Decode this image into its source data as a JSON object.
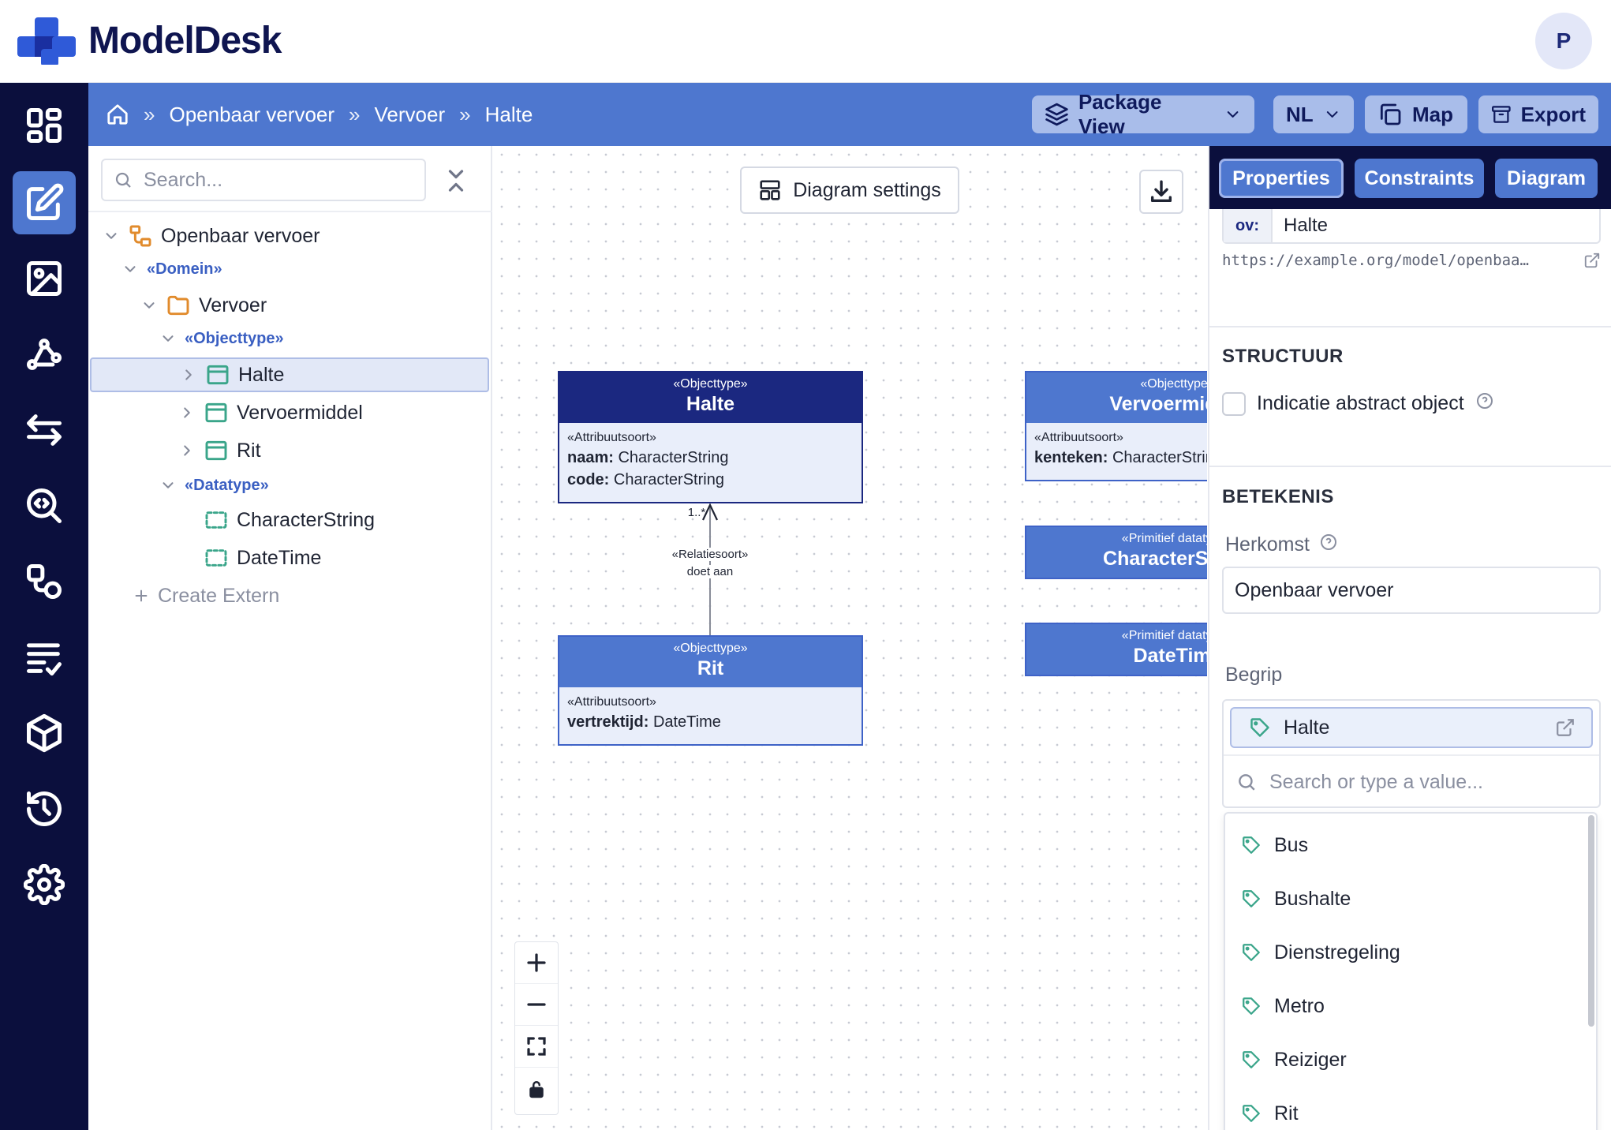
{
  "app": {
    "name": "ModelDesk",
    "avatar_initial": "P"
  },
  "sidebar": {
    "items": [
      {
        "icon": "dashboard-icon"
      },
      {
        "icon": "edit-icon",
        "active": true
      },
      {
        "icon": "image-icon"
      },
      {
        "icon": "graph-icon"
      },
      {
        "icon": "arrows-exchange-icon"
      },
      {
        "icon": "code-search-icon"
      },
      {
        "icon": "shapes-icon"
      },
      {
        "icon": "checklist-icon"
      },
      {
        "icon": "package-icon"
      },
      {
        "icon": "history-icon"
      },
      {
        "icon": "settings-icon"
      }
    ]
  },
  "breadcrumb": {
    "items": [
      "Openbaar vervoer",
      "Vervoer",
      "Halte"
    ],
    "separator": "»"
  },
  "toolbar": {
    "package_view": "Package View",
    "language": "NL",
    "map": "Map",
    "export": "Export"
  },
  "tree": {
    "search_placeholder": "Search...",
    "nodes": [
      {
        "label": "Openbaar vervoer",
        "kind": "model"
      },
      {
        "label": "«Domein»",
        "kind": "stereotype"
      },
      {
        "label": "Vervoer",
        "kind": "folder"
      },
      {
        "label": "«Objecttype»",
        "kind": "stereotype"
      },
      {
        "label": "Halte",
        "kind": "objecttype",
        "selected": true
      },
      {
        "label": "Vervoermiddel",
        "kind": "objecttype"
      },
      {
        "label": "Rit",
        "kind": "objecttype"
      },
      {
        "label": "«Datatype»",
        "kind": "stereotype"
      },
      {
        "label": "CharacterString",
        "kind": "datatype"
      },
      {
        "label": "DateTime",
        "kind": "datatype"
      }
    ],
    "create_extern": "Create Extern"
  },
  "canvas": {
    "settings_button": "Diagram settings",
    "boxes": {
      "halte": {
        "stereotype": "«Objecttype»",
        "name": "Halte",
        "attr_stereotype": "«Attribuutsoort»",
        "attrs": [
          {
            "name": "naam:",
            "type": "CharacterString"
          },
          {
            "name": "code:",
            "type": "CharacterString"
          }
        ]
      },
      "rit": {
        "stereotype": "«Objecttype»",
        "name": "Rit",
        "attr_stereotype": "«Attribuutsoort»",
        "attrs": [
          {
            "name": "vertrektijd:",
            "type": "DateTime"
          }
        ]
      },
      "vervoermiddel": {
        "stereotype": "«Objecttype»",
        "name": "Vervoermiddel",
        "attr_stereotype": "«Attribuutsoort»",
        "attrs": [
          {
            "name": "kenteken:",
            "type": "CharacterString"
          }
        ]
      },
      "characterstring": {
        "stereotype": "«Primitief datatype»",
        "name": "CharacterString"
      },
      "datetime": {
        "stereotype": "«Primitief datatype»",
        "name": "DateTime"
      }
    },
    "edge": {
      "multiplicity": "1..*",
      "stereotype": "«Relatiesoort»",
      "label": "doet aan"
    }
  },
  "panel": {
    "tabs": [
      "Properties",
      "Constraints",
      "Diagram"
    ],
    "prefix": "ov:",
    "name_value": "Halte",
    "uri": "https://example.org/model/openbaa…",
    "structuur_heading": "STRUCTUUR",
    "abstract_label": "Indicatie abstract object",
    "betekenis_heading": "BETEKENIS",
    "herkomst_label": "Herkomst",
    "herkomst_value": "Openbaar vervoer",
    "begrip_label": "Begrip",
    "begrip_selected": "Halte",
    "begrip_search_placeholder": "Search or type a value...",
    "options": [
      "Bus",
      "Bushalte",
      "Dienstregeling",
      "Metro",
      "Reiziger",
      "Rit"
    ]
  },
  "colors": {
    "navy": "#0b0f3d",
    "accent": "#4e77cf",
    "box_header": "#1b2880",
    "tag": "#3aa58a"
  }
}
